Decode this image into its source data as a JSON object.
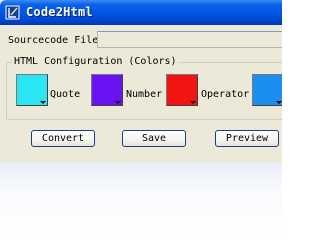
{
  "window": {
    "title": "Code2Html",
    "titlebar_color": "#0055e5",
    "body_color": "#ece9d8"
  },
  "sourcecode": {
    "label": "Sourcecode File:",
    "value": ""
  },
  "html_config": {
    "legend": "HTML Configuration (Colors)",
    "colors": [
      {
        "label": "Quote",
        "color": "#2ae5f3"
      },
      {
        "label": "Number",
        "color": "#6a12f2"
      },
      {
        "label": "Operator",
        "color": "#f21313"
      },
      {
        "label": "",
        "color": "#1a8ff0"
      }
    ]
  },
  "buttons": {
    "convert": "Convert",
    "save": "Save",
    "preview": "Preview"
  },
  "icons": {
    "app": "code-pen-icon",
    "dropdown": "chevron-down-icon"
  }
}
